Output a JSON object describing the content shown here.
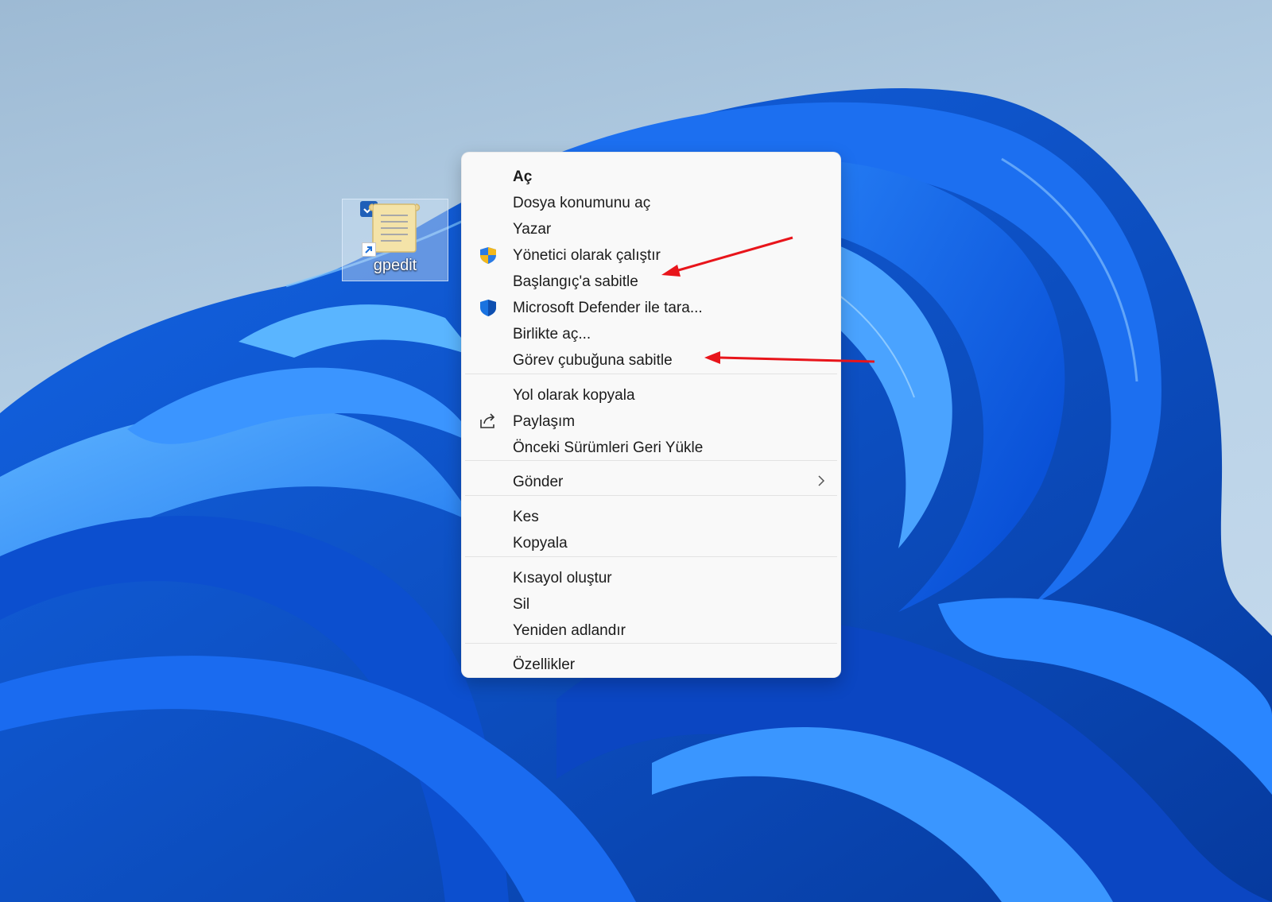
{
  "desktop": {
    "icon": {
      "label": "gpedit",
      "selected": true,
      "type": "shortcut"
    }
  },
  "context_menu": {
    "items": [
      {
        "label": "Aç",
        "bold": true,
        "icon": ""
      },
      {
        "label": "Dosya konumunu aç",
        "icon": ""
      },
      {
        "label": "Yazar",
        "icon": ""
      },
      {
        "label": "Yönetici olarak çalıştır",
        "icon": "uac-shield-icon"
      },
      {
        "label": "Başlangıç'a sabitle",
        "icon": ""
      },
      {
        "label": "Microsoft Defender ile tara...",
        "icon": "defender-shield-icon"
      },
      {
        "label": "Birlikte aç...",
        "icon": ""
      },
      {
        "label": "Görev çubuğuna sabitle",
        "icon": ""
      },
      {
        "label": "Yol olarak kopyala",
        "icon": ""
      },
      {
        "label": "Paylaşım",
        "icon": "share-icon"
      },
      {
        "label": "Önceki Sürümleri Geri Yükle",
        "icon": ""
      },
      {
        "label": "Gönder",
        "icon": "",
        "submenu": true
      },
      {
        "label": "Kes",
        "icon": ""
      },
      {
        "label": "Kopyala",
        "icon": ""
      },
      {
        "label": "Kısayol oluştur",
        "icon": ""
      },
      {
        "label": "Sil",
        "icon": ""
      },
      {
        "label": "Yeniden adlandır",
        "icon": ""
      },
      {
        "label": "Özellikler",
        "icon": ""
      }
    ]
  },
  "annotations": {
    "arrow_color": "#e8151b",
    "pointing_to": [
      "Başlangıç'a sabitle",
      "Görev çubuğuna sabitle"
    ]
  },
  "colors": {
    "menu_background": "#f9f9f9",
    "wallpaper_sky": "#a9c6df",
    "wallpaper_bloom": "#0a5ce6"
  }
}
